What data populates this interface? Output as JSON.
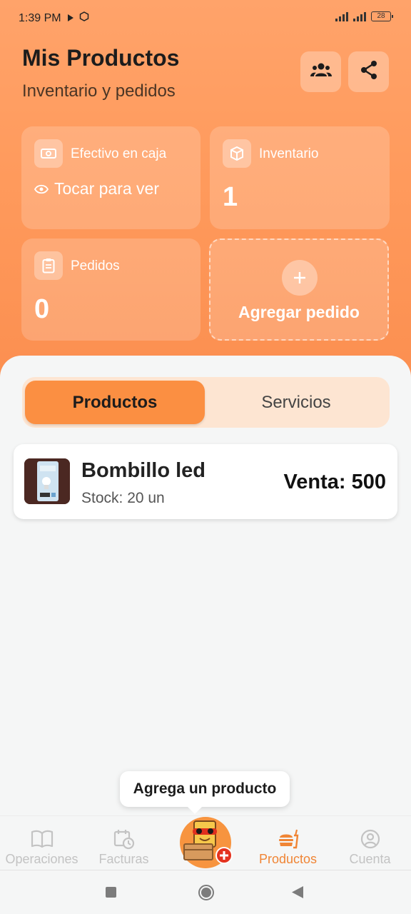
{
  "status_bar": {
    "time": "1:39 PM",
    "battery": "28"
  },
  "header": {
    "title": "Mis Productos",
    "subtitle": "Inventario y pedidos",
    "team_icon": "team-icon",
    "share_icon": "share-icon"
  },
  "cards": {
    "cash": {
      "label": "Efectivo en caja",
      "hint": "Tocar para ver",
      "icon": "cash-icon"
    },
    "inventory": {
      "label": "Inventario",
      "value": "1",
      "icon": "box-icon"
    },
    "orders": {
      "label": "Pedidos",
      "value": "0",
      "icon": "clipboard-icon"
    },
    "add_order": {
      "label": "Agregar pedido",
      "icon": "plus-icon"
    }
  },
  "tabs": [
    {
      "label": "Productos",
      "active": true
    },
    {
      "label": "Servicios",
      "active": false
    }
  ],
  "products": [
    {
      "name": "Bombillo led",
      "stock": "Stock: 20 un",
      "price": "Venta: 500"
    }
  ],
  "tooltip": "Agrega un producto",
  "bottom_nav": [
    {
      "label": "Operaciones",
      "icon": "book-icon"
    },
    {
      "label": "Facturas",
      "icon": "calendar-clock-icon"
    },
    {
      "label": "",
      "icon": "add-product-mascot-icon"
    },
    {
      "label": "Productos",
      "icon": "burger-icon",
      "active": true
    },
    {
      "label": "Cuenta",
      "icon": "user-circle-icon"
    }
  ],
  "colors": {
    "accent": "#fb8f42",
    "header_top": "#ffa36a",
    "header_bottom": "#fb8e4f"
  }
}
